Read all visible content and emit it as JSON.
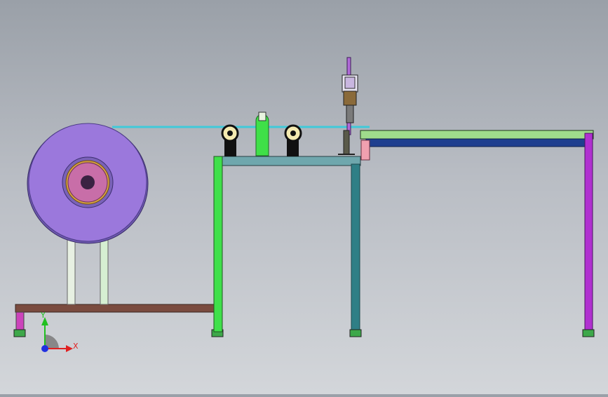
{
  "viewport": {
    "background_top": "#9aa0a8",
    "background_bottom": "#d3d6da"
  },
  "triad": {
    "x_label": "X",
    "y_label": "Y",
    "x_color": "#e02020",
    "y_color": "#20c020",
    "z_color": "#2030e0"
  },
  "parts": {
    "spool": {
      "color": "#9b78dc",
      "hub_color": "#c86ea8"
    },
    "spool_legs": {
      "color": "#dff0dc"
    },
    "base_table": {
      "color": "#7a4b3f"
    },
    "base_feet": {
      "color": "#cc44bb",
      "foot_pad_color": "#3da84a"
    },
    "mid_table": {
      "top_color": "#6fa7ad",
      "left_leg_color": "#3fe04a",
      "right_leg_color": "#2f7f86"
    },
    "wire": {
      "color": "#3fc9d9"
    },
    "rollers": {
      "color": "#111111",
      "rim_color": "#f4eab0"
    },
    "guide_post": {
      "color": "#3fe048"
    },
    "cutter": {
      "color": "#b06ad8",
      "body_color": "#8a6a3a"
    },
    "conveyor": {
      "top_color": "#9fdc8c",
      "bottom_color": "#1f3f8f",
      "leg_color": "#b030d0",
      "end_block_color": "#f0a0b0"
    }
  }
}
